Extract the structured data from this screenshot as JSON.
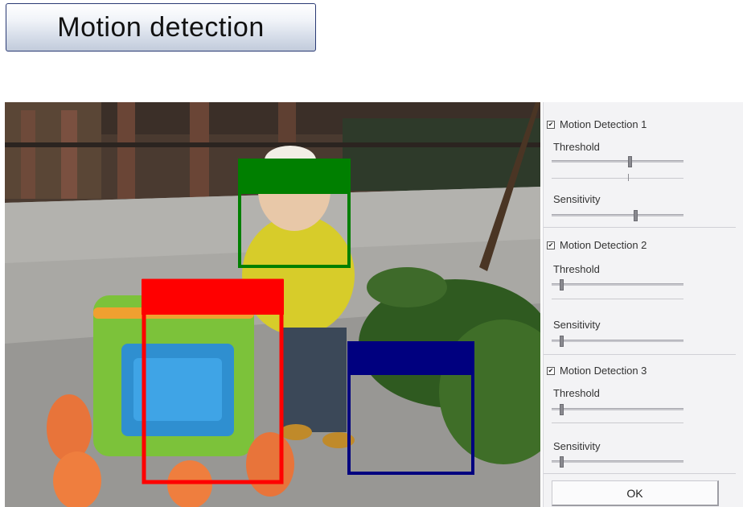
{
  "header": {
    "title": "Motion detection"
  },
  "panel": {
    "groups": [
      {
        "label": "Motion Detection 1",
        "checked": true,
        "threshold_label": "Threshold",
        "sensitivity_label": "Sensitivity",
        "threshold": 0.58,
        "sensitivity": 0.62,
        "check_glyph": "✔"
      },
      {
        "label": "Motion Detection 2",
        "checked": true,
        "threshold_label": "Threshold",
        "sensitivity_label": "Sensitivity",
        "threshold": 0.06,
        "sensitivity": 0.06,
        "check_glyph": "✔"
      },
      {
        "label": "Motion Detection 3",
        "checked": true,
        "threshold_label": "Threshold",
        "sensitivity_label": "Sensitivity",
        "threshold": 0.06,
        "sensitivity": 0.06,
        "check_glyph": "✔"
      }
    ],
    "ok_label": "OK"
  },
  "regions": [
    {
      "name": "region-1",
      "color": "#007f00"
    },
    {
      "name": "region-2",
      "color": "#ff0000"
    },
    {
      "name": "region-3",
      "color": "#00007f"
    }
  ]
}
